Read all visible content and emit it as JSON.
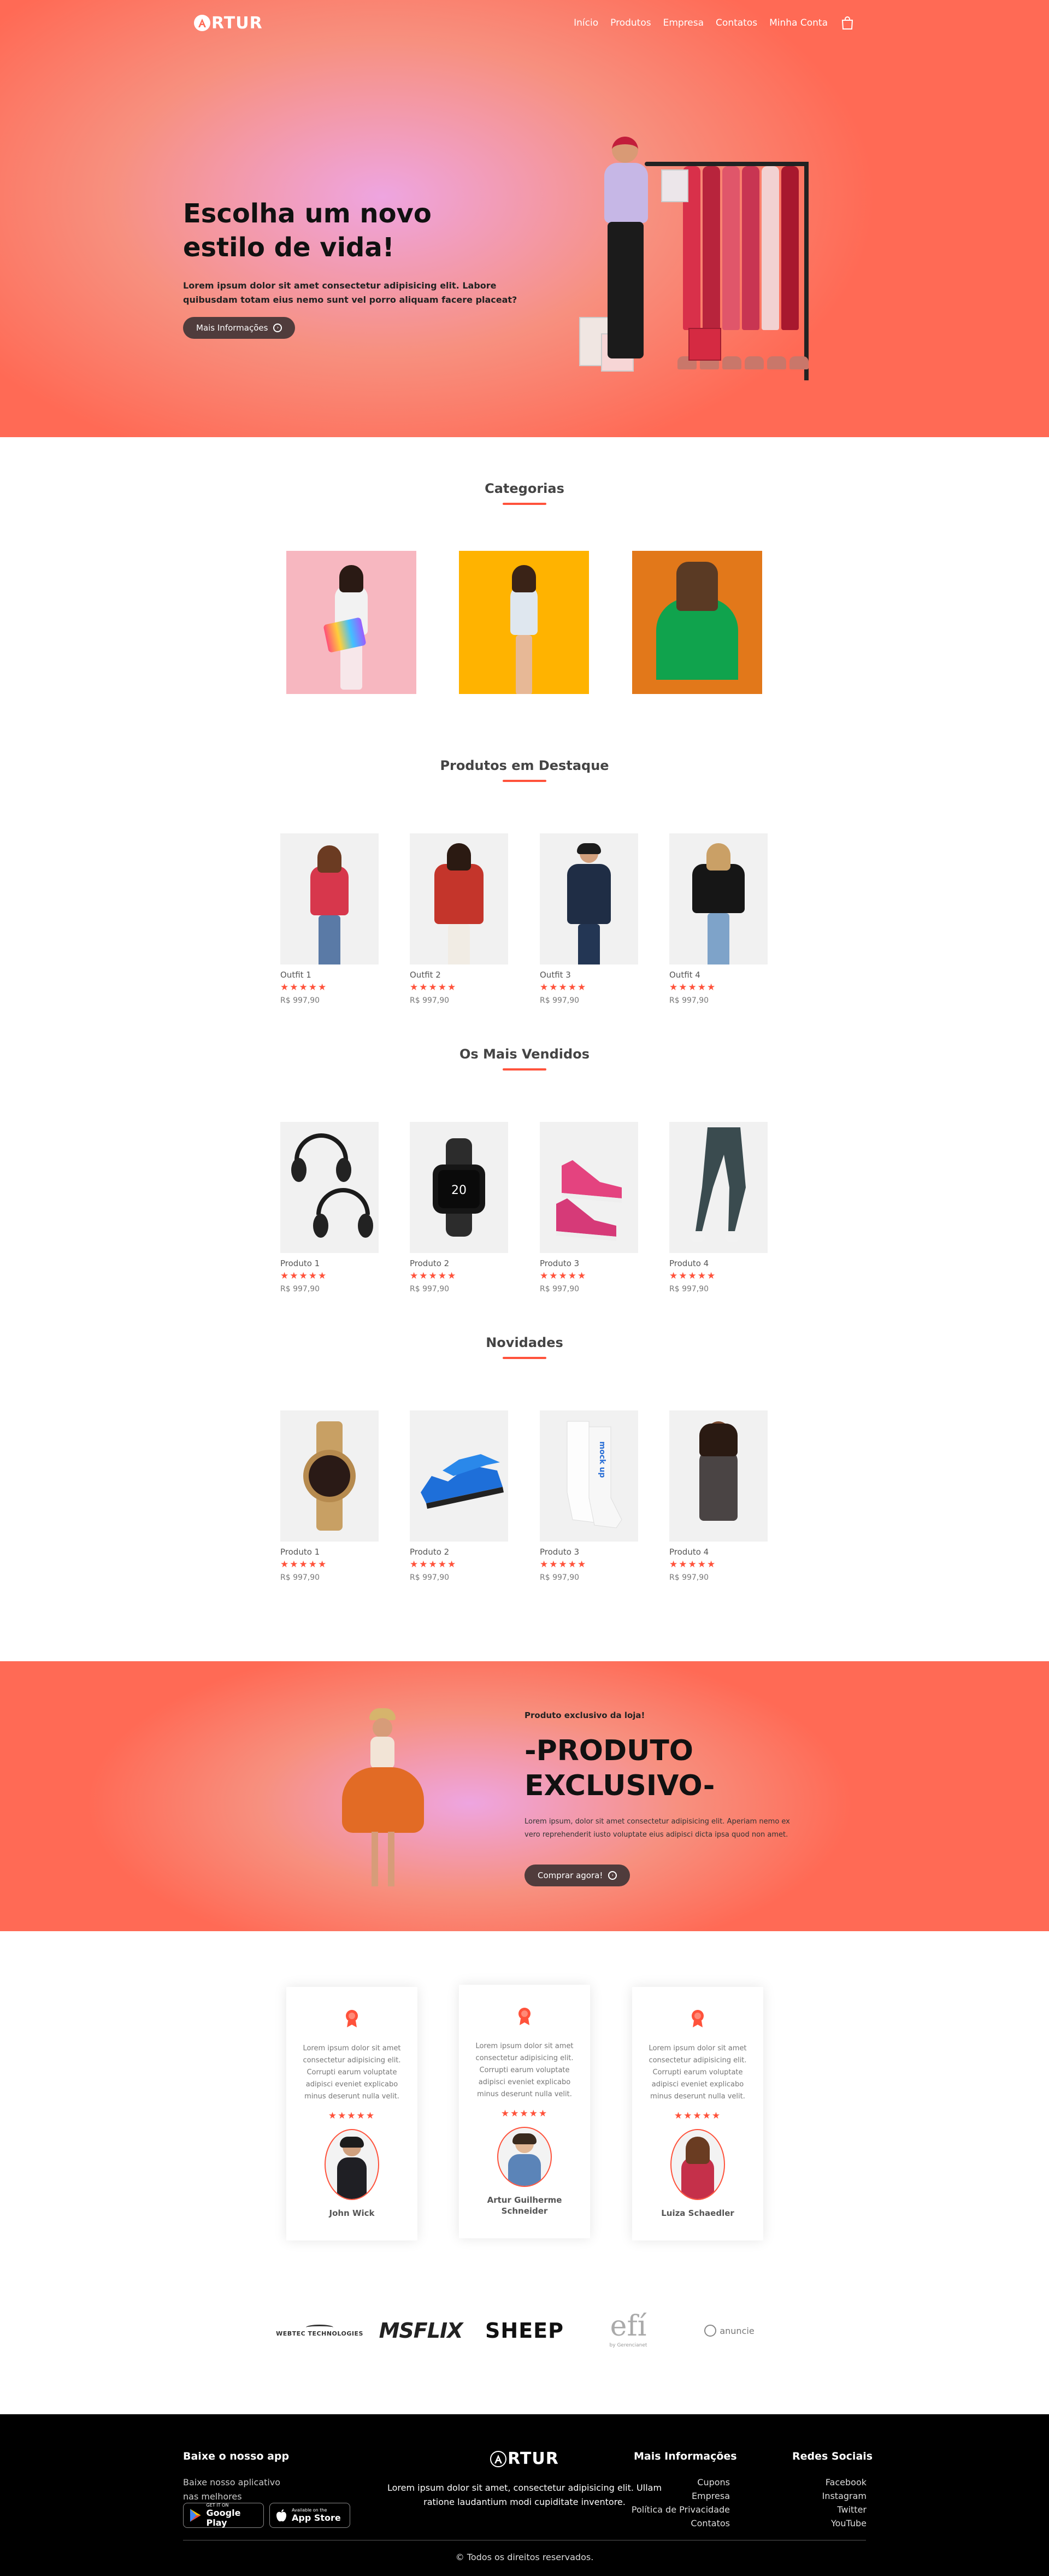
{
  "brand": {
    "name": "RTUR"
  },
  "nav": {
    "items": [
      "Início",
      "Produtos",
      "Empresa",
      "Contatos",
      "Minha Conta"
    ]
  },
  "hero": {
    "title": "Escolha um novo estilo de vida!",
    "text": "Lorem ipsum dolor sit amet consectetur adipisicing elit. Labore quibusdam totam eius nemo sunt vel porro aliquam facere placeat?",
    "button": "Mais Informações"
  },
  "categories": {
    "title": "Categorias"
  },
  "featured": {
    "title": "Produtos em Destaque",
    "items": [
      {
        "name": "Outfit 1",
        "stars": "★★★★★",
        "price": "R$ 997,90"
      },
      {
        "name": "Outfit 2",
        "stars": "★★★★★",
        "price": "R$ 997,90"
      },
      {
        "name": "Outfit 3",
        "stars": "★★★★★",
        "price": "R$ 997,90"
      },
      {
        "name": "Outfit 4",
        "stars": "★★★★★",
        "price": "R$ 997,90"
      }
    ]
  },
  "bestsellers": {
    "title": "Os Mais Vendidos",
    "items": [
      {
        "name": "Produto 1",
        "stars": "★★★★★",
        "price": "R$ 997,90"
      },
      {
        "name": "Produto 2",
        "stars": "★★★★★",
        "price": "R$ 997,90"
      },
      {
        "name": "Produto 3",
        "stars": "★★★★★",
        "price": "R$ 997,90"
      },
      {
        "name": "Produto 4",
        "stars": "★★★★★",
        "price": "R$ 997,90"
      }
    ],
    "watch_time": "20"
  },
  "news": {
    "title": "Novidades",
    "items": [
      {
        "name": "Produto 1",
        "stars": "★★★★★",
        "price": "R$ 997,90"
      },
      {
        "name": "Produto 2",
        "stars": "★★★★★",
        "price": "R$ 997,90"
      },
      {
        "name": "Produto 3",
        "stars": "★★★★★",
        "price": "R$ 997,90"
      },
      {
        "name": "Produto 4",
        "stars": "★★★★★",
        "price": "R$ 997,90"
      }
    ],
    "sock_text": "mock up"
  },
  "promo": {
    "small": "Produto exclusivo da loja!",
    "title": "-PRODUTO EXCLUSIVO-",
    "text": "Lorem ipsum, dolor sit amet consectetur adipisicing elit. Aperiam nemo ex vero reprehenderit iusto voluptate eius adipisci dicta ipsa quod non amet.",
    "button": "Comprar agora!"
  },
  "testimonials": [
    {
      "text": "Lorem ipsum dolor sit amet consectetur adipisicing elit. Corrupti earum voluptate adipisci eveniet explicabo minus deserunt nulla velit.",
      "stars": "★★★★★",
      "name": "John Wick"
    },
    {
      "text": "Lorem ipsum dolor sit amet consectetur adipisicing elit. Corrupti earum voluptate adipisci eveniet explicabo minus deserunt nulla velit.",
      "stars": "★★★★★",
      "name": "Artur Guilherme Schneider"
    },
    {
      "text": "Lorem ipsum dolor sit amet consectetur adipisicing elit. Corrupti earum voluptate adipisci eveniet explicabo minus deserunt nulla velit.",
      "stars": "★★★★★",
      "name": "Luiza Schaedler"
    }
  ],
  "brands": {
    "webtec": "WEBTEC TECHNOLOGIES",
    "msflix": "MSFLIX",
    "sheep": "SHEEP",
    "efi": "efí",
    "efi_sub": "by Gerencianet",
    "anuncie": "anuncie"
  },
  "footer": {
    "app_title": "Baixe o nosso app",
    "app_text": "Baixe nosso aplicativo nas melhores plataformas!",
    "google_small": "GET IT ON",
    "google_big": "Google Play",
    "apple_small": "Available on the",
    "apple_big": "App Store",
    "about": "Lorem ipsum dolor sit amet, consectetur adipisicing elit. Ullam ratione laudantium modi cupiditate inventore.",
    "info_title": "Mais Informações",
    "info_links": [
      "Cupons",
      "Empresa",
      "Política de Privacidade",
      "Contatos"
    ],
    "social_title": "Redes Sociais",
    "social_links": [
      "Facebook",
      "Instagram",
      "Twitter",
      "YouTube"
    ],
    "copyright": "© Todos os direitos reservados."
  },
  "colors": {
    "accent": "#ff523b",
    "button_dark": "#503c3c",
    "footer_bg": "#000000"
  }
}
